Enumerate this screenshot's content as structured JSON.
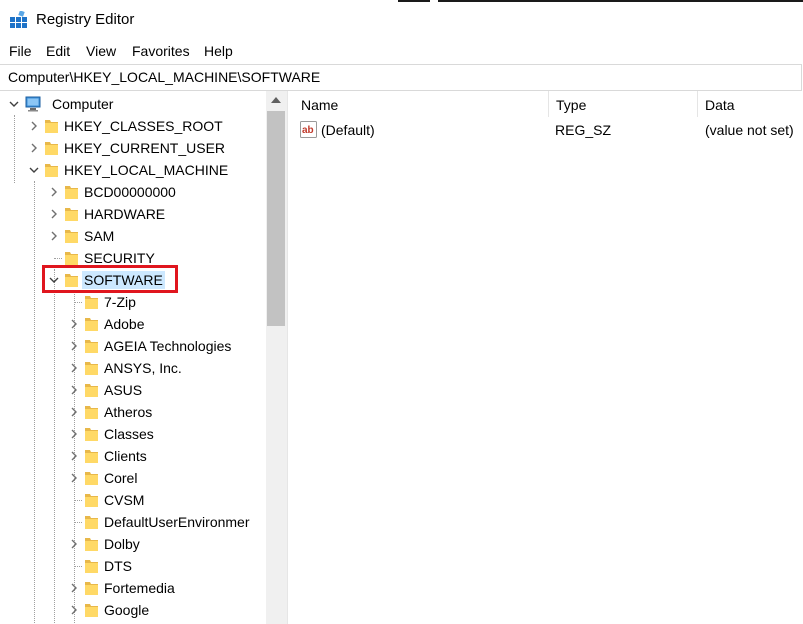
{
  "window": {
    "title": "Registry Editor"
  },
  "menu": [
    "File",
    "Edit",
    "View",
    "Favorites",
    "Help"
  ],
  "address": "Computer\\HKEY_LOCAL_MACHINE\\SOFTWARE",
  "tree": [
    {
      "label": "Computer",
      "level": 0,
      "expander": "open",
      "icon": "computer-icon"
    },
    {
      "label": "HKEY_CLASSES_ROOT",
      "level": 1,
      "expander": "closed",
      "icon": "folder-icon"
    },
    {
      "label": "HKEY_CURRENT_USER",
      "level": 1,
      "expander": "closed",
      "icon": "folder-icon"
    },
    {
      "label": "HKEY_LOCAL_MACHINE",
      "level": 1,
      "expander": "open",
      "icon": "folder-icon"
    },
    {
      "label": "BCD00000000",
      "level": 2,
      "expander": "closed",
      "icon": "folder-icon"
    },
    {
      "label": "HARDWARE",
      "level": 2,
      "expander": "closed",
      "icon": "folder-icon"
    },
    {
      "label": "SAM",
      "level": 2,
      "expander": "closed",
      "icon": "folder-icon"
    },
    {
      "label": "SECURITY",
      "level": 2,
      "expander": "none",
      "icon": "folder-icon"
    },
    {
      "label": "SOFTWARE",
      "level": 2,
      "expander": "open",
      "icon": "folder-icon",
      "selected": true
    },
    {
      "label": "7-Zip",
      "level": 3,
      "expander": "none",
      "icon": "folder-icon"
    },
    {
      "label": "Adobe",
      "level": 3,
      "expander": "closed",
      "icon": "folder-icon"
    },
    {
      "label": "AGEIA Technologies",
      "level": 3,
      "expander": "closed",
      "icon": "folder-icon"
    },
    {
      "label": "ANSYS, Inc.",
      "level": 3,
      "expander": "closed",
      "icon": "folder-icon"
    },
    {
      "label": "ASUS",
      "level": 3,
      "expander": "closed",
      "icon": "folder-icon"
    },
    {
      "label": "Atheros",
      "level": 3,
      "expander": "closed",
      "icon": "folder-icon"
    },
    {
      "label": "Classes",
      "level": 3,
      "expander": "closed",
      "icon": "folder-icon"
    },
    {
      "label": "Clients",
      "level": 3,
      "expander": "closed",
      "icon": "folder-icon"
    },
    {
      "label": "Corel",
      "level": 3,
      "expander": "closed",
      "icon": "folder-icon"
    },
    {
      "label": "CVSM",
      "level": 3,
      "expander": "none",
      "icon": "folder-icon"
    },
    {
      "label": "DefaultUserEnvironmer",
      "level": 3,
      "expander": "none",
      "icon": "folder-icon"
    },
    {
      "label": "Dolby",
      "level": 3,
      "expander": "closed",
      "icon": "folder-icon"
    },
    {
      "label": "DTS",
      "level": 3,
      "expander": "none",
      "icon": "folder-icon"
    },
    {
      "label": "Fortemedia",
      "level": 3,
      "expander": "closed",
      "icon": "folder-icon"
    },
    {
      "label": "Google",
      "level": 3,
      "expander": "closed",
      "icon": "folder-icon"
    }
  ],
  "columns": [
    "Name",
    "Type",
    "Data"
  ],
  "values": [
    {
      "name": "(Default)",
      "type": "REG_SZ",
      "data": "(value not set)",
      "icon": "string-value-icon"
    }
  ],
  "colors": {
    "selection": "#cce8ff",
    "highlight_box": "#e0161e",
    "folder": "#ffd966"
  }
}
